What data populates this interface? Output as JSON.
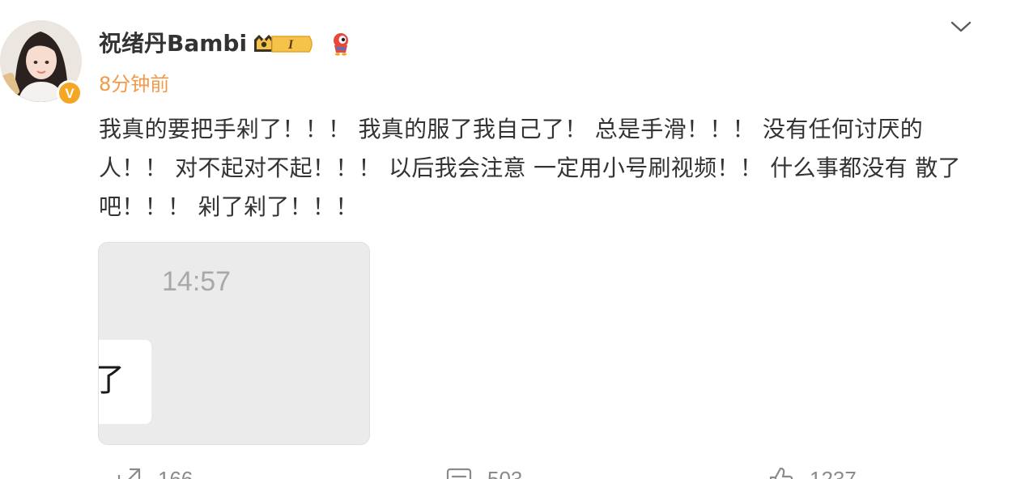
{
  "post": {
    "author": {
      "name": "祝绪丹Bambi",
      "verified_mark": "V",
      "vip_level": "I"
    },
    "timestamp": "8分钟前",
    "text": "我真的要把手剁了！！！ 我真的服了我自己了！ 总是手滑！！！ 没有任何讨厌的人！！ 对不起对不起！！！ 以后我会注意 一定用小号刷视频！！ 什么事都没有 散了吧！！！ 剁了剁了！！！",
    "image": {
      "time_text": "14:57",
      "bubble_text": "了"
    },
    "actions": {
      "repost_count": "166",
      "comment_count": "503",
      "like_count": "1237"
    }
  },
  "icons": {
    "menu": "chevron-down-icon",
    "repost": "share-arrow-icon",
    "comment": "comment-icon",
    "like": "thumbs-up-icon",
    "vip": "crown-vip-icon",
    "mascot": "mascot-icon"
  },
  "colors": {
    "timestamp": "#f2994a",
    "verified_badge": "#f5a623",
    "text": "#333333",
    "muted": "#8a8a8a"
  }
}
